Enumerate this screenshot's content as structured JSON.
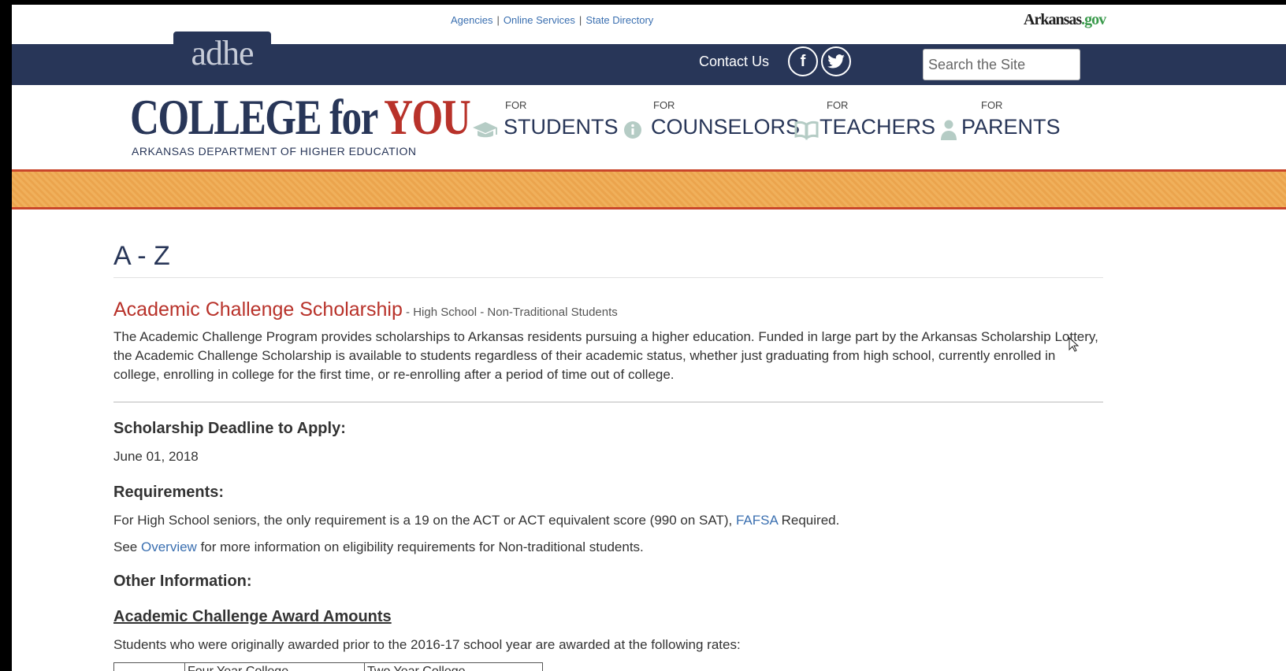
{
  "utility_bar": {
    "links": [
      "Agencies",
      "Online Services",
      "State Directory"
    ],
    "separator": "|",
    "state_logo_part1": "Arkansas",
    "state_logo_part2": ".gov"
  },
  "navbar": {
    "brand_tab": "adhe",
    "contact_label": "Contact Us",
    "social": [
      "facebook-icon",
      "twitter-icon"
    ],
    "facebook_glyph": "f",
    "search_placeholder": "Search the Site"
  },
  "logo": {
    "part1": "COLLEGE for ",
    "part2": "YOU",
    "subtitle": "ARKANSAS DEPARTMENT OF HIGHER EDUCATION"
  },
  "audience_nav": [
    {
      "prefix": "FOR",
      "label": "STUDENTS",
      "icon": "graduation-cap-icon"
    },
    {
      "prefix": "FOR",
      "label": "COUNSELORS",
      "icon": "info-icon"
    },
    {
      "prefix": "FOR",
      "label": "TEACHERS",
      "icon": "book-icon"
    },
    {
      "prefix": "FOR",
      "label": "PARENTS",
      "icon": "person-icon"
    }
  ],
  "colors": {
    "navy": "#283658",
    "accent_red": "#b8322a",
    "band_orange": "#eba44d",
    "link_blue": "#3a6fb0"
  },
  "content": {
    "page_title": "A - Z",
    "scholarship_title": "Academic Challenge Scholarship",
    "tags": " - High School  - Non-Traditional Students",
    "description": "The Academic Challenge Program provides scholarships to Arkansas residents pursuing a higher education. Funded in large part by the Arkansas Scholarship Lottery, the Academic Challenge Scholarship is available to students regardless of their academic status, whether just graduating from high school, currently enrolled in college, enrolling in college for the first time, or re-enrolling after a period of time out of college.",
    "deadline_heading": "Scholarship Deadline to Apply:",
    "deadline_date": "June 01, 2018",
    "requirements_heading": "Requirements:",
    "req1_text": "For High School seniors, the only requirement is a 19 on the ACT or ACT equivalent score (990 on SAT), ",
    "req1_link": "FAFSA",
    "req1_after": " Required.",
    "req2_before": "See ",
    "req2_link": "Overview",
    "req2_after": " for more information on eligibility requirements for Non-traditional students.",
    "other_heading": "Other Information:",
    "award_heading": "Academic Challenge Award Amounts",
    "rates_text": "Students who were originally awarded prior to the 2016-17 school year are awarded at the following rates:",
    "table_headers": [
      "",
      "Four Year College",
      "Two Year College"
    ]
  }
}
